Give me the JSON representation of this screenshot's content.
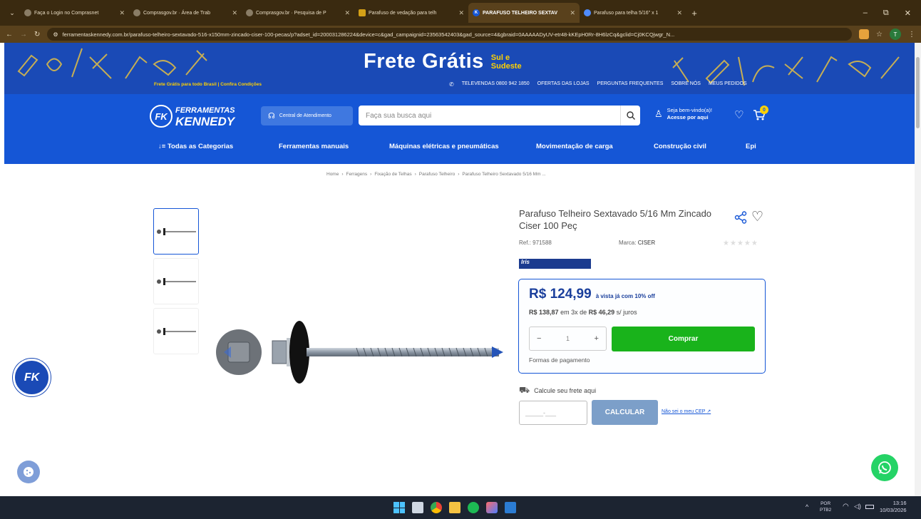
{
  "browser": {
    "tabs": [
      {
        "title": "Faça o Login no Comprasnet",
        "active": false
      },
      {
        "title": "Comprasgov.br · Área de Trab",
        "active": false
      },
      {
        "title": "Comprasgov.br · Pesquisa de P",
        "active": false
      },
      {
        "title": "Parafuso de vedação para telh",
        "active": false
      },
      {
        "title": "PARAFUSO TELHEIRO SEXTAV",
        "active": true
      },
      {
        "title": "Parafuso para telha 5/16\" x 1",
        "active": false
      }
    ],
    "url": "ferramentaskennedy.com.br/parafuso-telheiro-sextavado-516-x150mm-zincado-ciser-100-pecas/p?adset_id=200031286224&device=c&gad_campaignid=23563542403&gad_source=4&gbraid=0AAAAADyUV-etr48-kKEpH0Rr-8H6lzCq&gclid=Cj0KCQjwgr_N...",
    "profile_initial": "T"
  },
  "banner": {
    "headline": "Frete Grátis",
    "regions_line1": "Sul e",
    "regions_line2": "Sudeste",
    "subtext": "Frete Grátis para todo Brasil | Confira Condições",
    "links": [
      "TELEVENDAS 0800 942 1850",
      "OFERTAS DAS LOJAS",
      "PERGUNTAS FREQUENTES",
      "SOBRE NÓS",
      "MEUS PEDIDOS"
    ]
  },
  "header": {
    "logo_line1": "FERRAMENTAS",
    "logo_line2": "KENNEDY",
    "support_label": "Central de Atendimento",
    "search_placeholder": "Faça sua busca aqui",
    "account_line1": "Seja bem-vindo(a)!",
    "account_line2": "Acesse por aqui",
    "cart_count": "0"
  },
  "categories": [
    "Todas as Categorias",
    "Ferramentas manuais",
    "Máquinas elétricas e pneumáticas",
    "Movimentação de carga",
    "Construção civil",
    "Epi"
  ],
  "breadcrumb": [
    "Home",
    "Ferragens",
    "Fixação de Telhas",
    "Parafuso Telheiro",
    "Parafuso Telheiro Sextavado 5/16 Mm ..."
  ],
  "product": {
    "title": "Parafuso Telheiro Sextavado 5/16 Mm Zincado Ciser 100 Peç",
    "ref_label": "Ref.:",
    "ref": "971588",
    "brand_label": "Marca:",
    "brand": "CISER",
    "stars_filled": 0,
    "stars_total": 5,
    "tag": "Iris",
    "price": "R$ 124,99",
    "price_note": "à vista já com 10% off",
    "installment_prefix": "R$ 138,87",
    "installment_mid": "em 3x de",
    "installment_value": "R$ 46,29",
    "installment_suffix": "s/ juros",
    "quantity": "1",
    "buy_label": "Comprar",
    "payment_link": "Formas de pagamento",
    "shipping_label": "Calcule seu frete aqui",
    "cep_placeholder": "_____-___",
    "calc_label": "CALCULAR",
    "cep_help": "Não sei o meu CEP"
  },
  "taskbar": {
    "lang_line1": "POR",
    "lang_line2": "PTB2",
    "time": "13:16",
    "date": "10/03/2026"
  },
  "colors": {
    "brand_blue": "#1556d6",
    "banner_blue": "#1a4ab6",
    "price_blue": "#1a3f9c",
    "buy_green": "#19b31b",
    "calc_blue": "#7c9fc9",
    "whatsapp": "#25d366",
    "tag_navy": "#1b3b8f"
  }
}
